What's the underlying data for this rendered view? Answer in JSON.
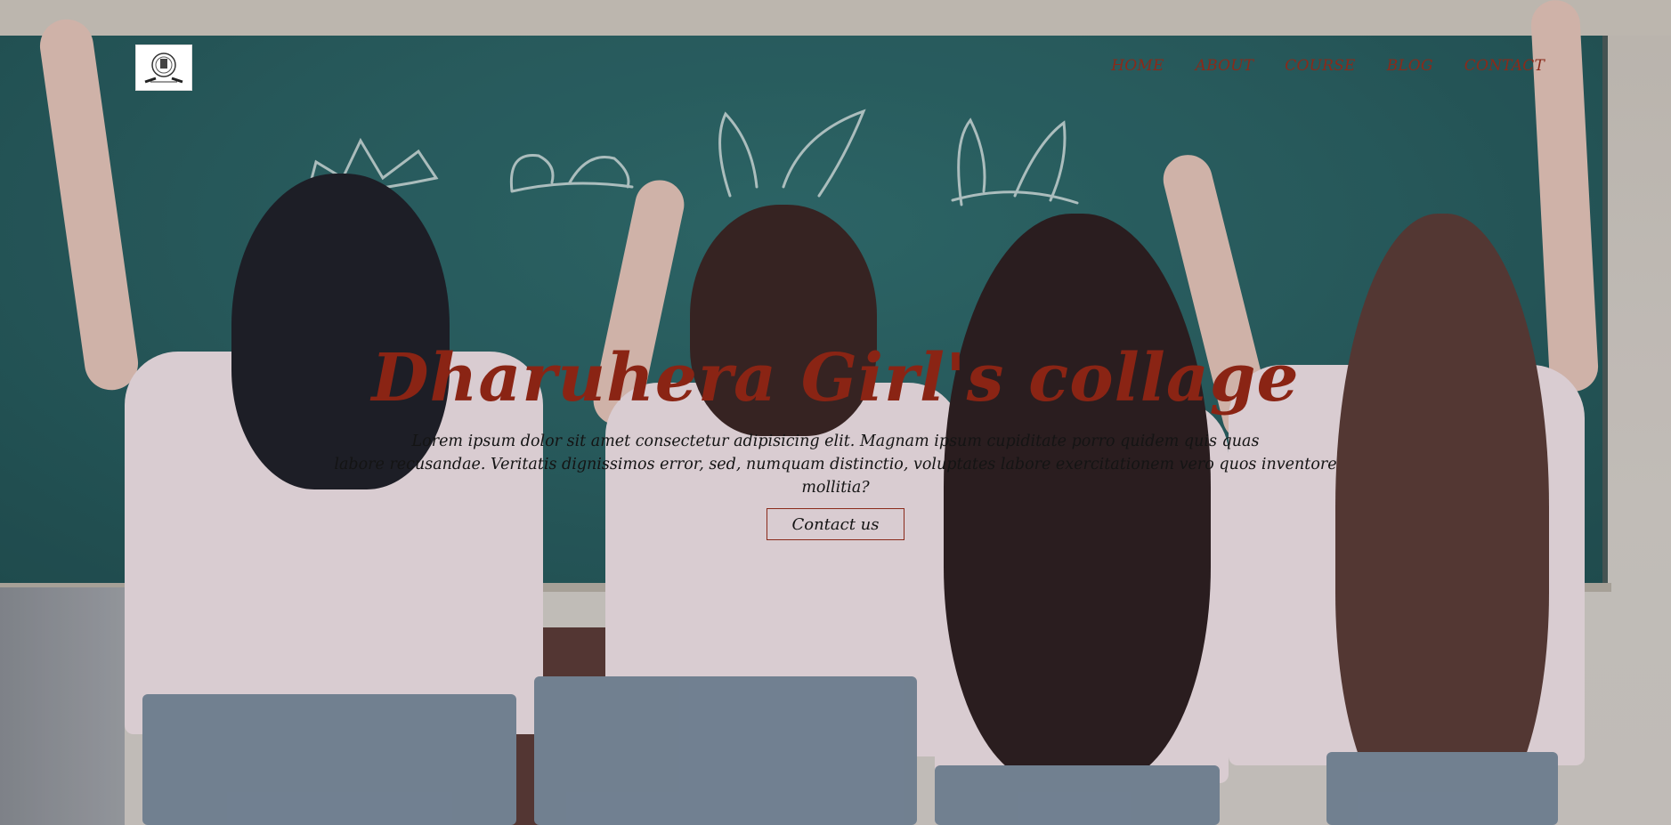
{
  "header": {
    "logo_alt": "college emblem",
    "nav": [
      {
        "label": "HOME"
      },
      {
        "label": "ABOUT"
      },
      {
        "label": "COURSE"
      },
      {
        "label": "BLOG"
      },
      {
        "label": "CONTACT"
      }
    ]
  },
  "hero": {
    "title": "Dharuhera Girl's collage",
    "description_line1": "Lorem ipsum dolor sit amet consectetur adipisicing elit. Magnam ipsum cupiditate porro quidem quis quas",
    "description_line2": "labore recusandae. Veritatis dignissimos error, sed, numquam distinctio, voluptates labore exercitationem vero quos inventore mollitia?",
    "button_label": "Contact us"
  },
  "colors": {
    "accent": "#8a2414",
    "nav_text": "#8a2a1a",
    "body_text": "#141414",
    "chalkboard": "#2a6664"
  },
  "icons": {
    "logo": "emblem-icon"
  }
}
